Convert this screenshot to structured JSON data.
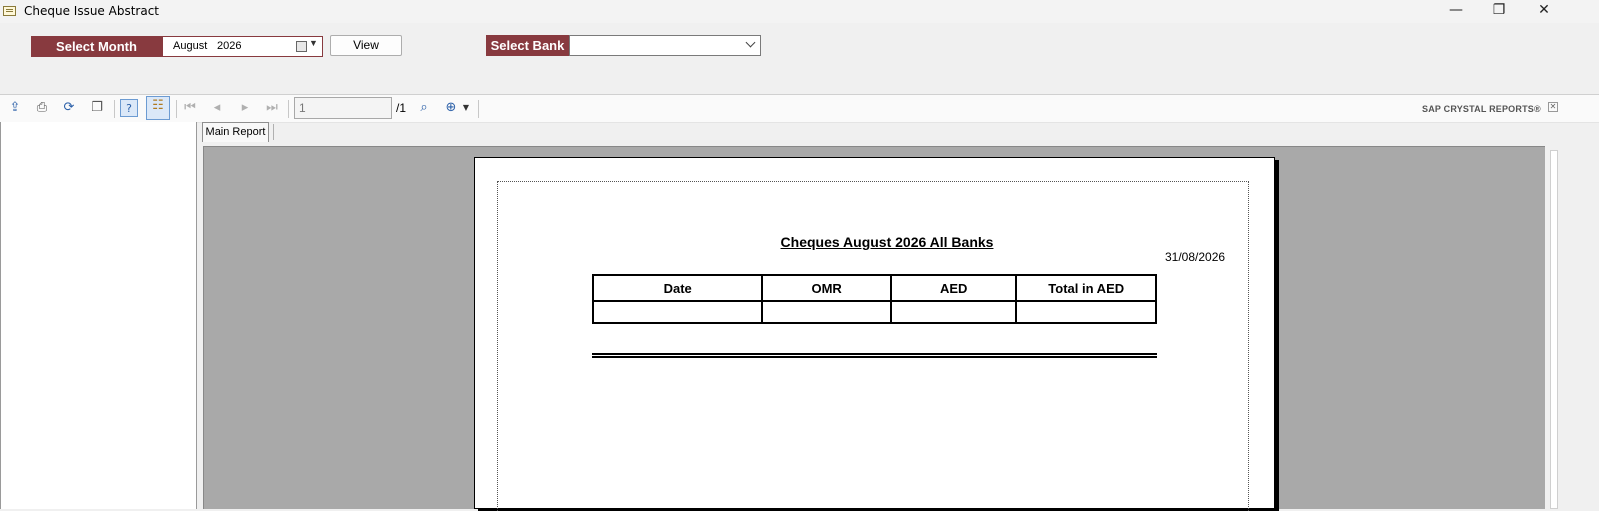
{
  "window": {
    "title": "Cheque Issue Abstract",
    "minimize": "—",
    "restore": "❐",
    "close": "✕"
  },
  "filters": {
    "month_label": "Select Month",
    "month_value": "August",
    "year_value": "2026",
    "view_label": "View",
    "bank_label": "Select Bank",
    "bank_value": ""
  },
  "viewer_toolbar": {
    "page_number": "1",
    "page_total": "/1",
    "brand": "SAP CRYSTAL REPORTS®",
    "icons": [
      "export-icon",
      "print-icon",
      "refresh-icon",
      "copy-icon",
      "help-icon",
      "group-tree-icon",
      "first-page-icon",
      "prev-page-icon",
      "next-page-icon",
      "last-page-icon",
      "find-icon",
      "zoom-icon"
    ]
  },
  "tabs": {
    "main_report": "Main Report"
  },
  "report": {
    "title": "Cheques August 2026 All Banks",
    "date": "31/08/2026",
    "columns": [
      "Date",
      "OMR",
      "AED",
      "Total in AED"
    ],
    "rows": [
      [
        "",
        "",
        "",
        ""
      ]
    ]
  },
  "colors": {
    "label_bg": "#883a3f",
    "viewer_bg": "#a9a9a9"
  }
}
